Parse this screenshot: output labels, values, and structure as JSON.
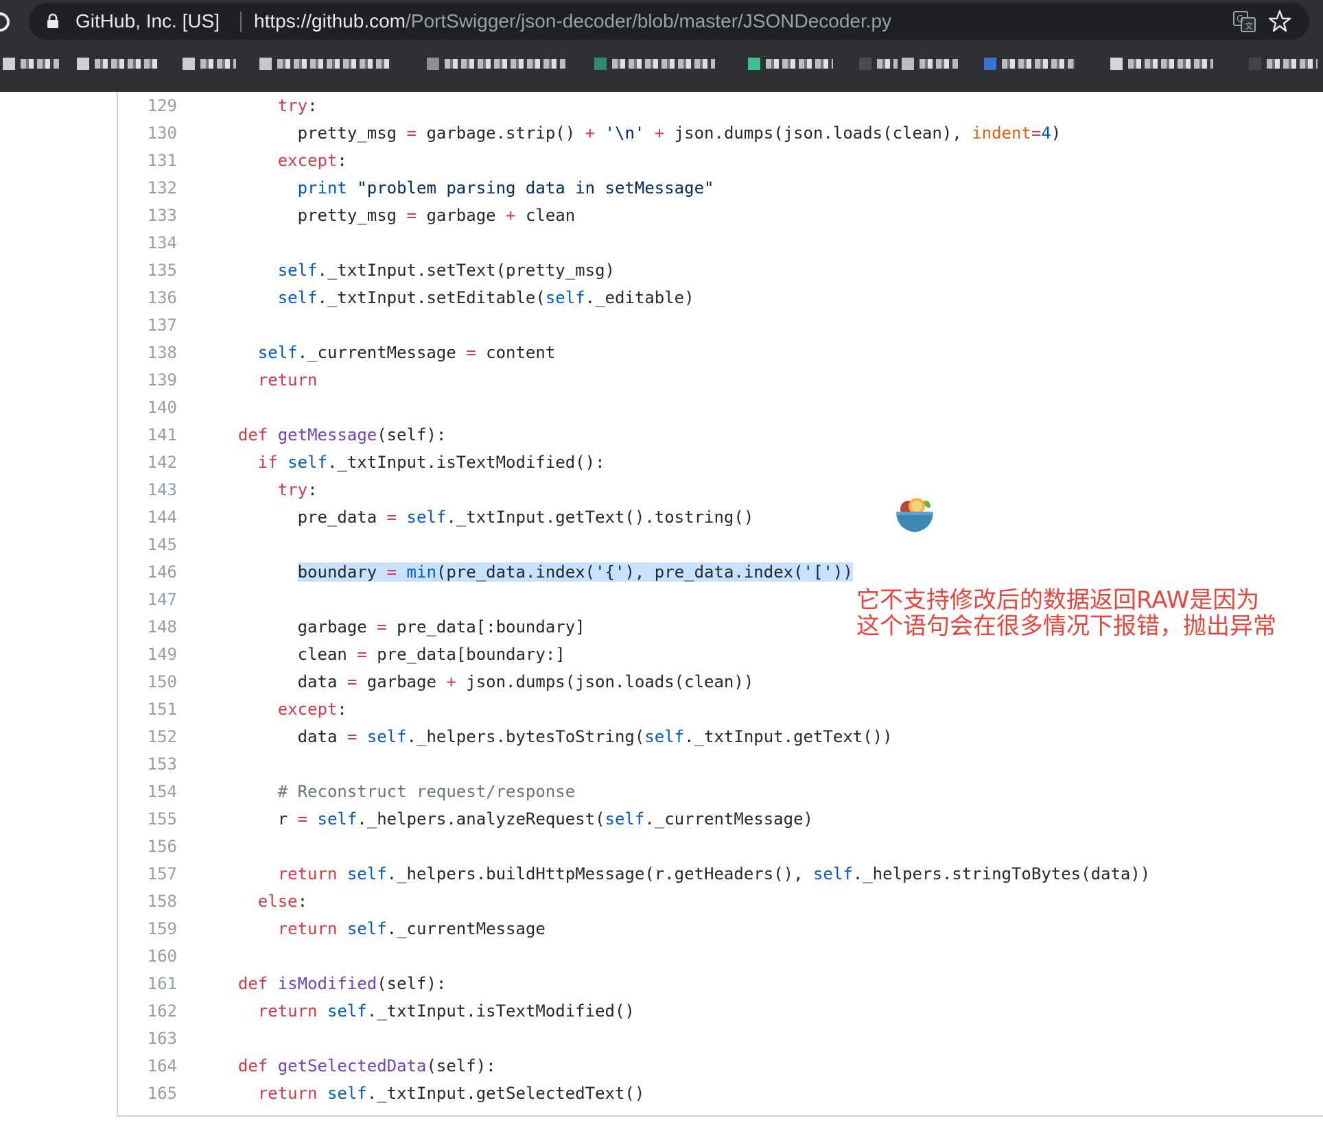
{
  "browser": {
    "site_identity": "GitHub, Inc. [US]",
    "url_host": "https://github.com",
    "url_path": "/PortSwigger/json-decoder/blob/master/JSONDecoder.py",
    "icons": [
      "reload-icon",
      "lock-icon",
      "translate-icon",
      "star-icon"
    ],
    "bookmarks_note_hidden": true
  },
  "code": {
    "lines": [
      {
        "n": "129",
        "html": "      <span class=\"kw\">try</span>:"
      },
      {
        "n": "130",
        "html": "        pretty_msg <span class=\"kw\">=</span> garbage.strip() <span class=\"kw\">+</span> <span class=\"st\">'\\n'</span> <span class=\"kw\">+</span> json.dumps(json.loads(clean), <span class=\"pm\">indent</span><span class=\"kw\">=</span><span class=\"sf\">4</span>)"
      },
      {
        "n": "131",
        "html": "      <span class=\"kw\">except</span>:"
      },
      {
        "n": "132",
        "html": "        <span class=\"sf\">print</span> <span class=\"st\">\"problem parsing data in setMessage\"</span>"
      },
      {
        "n": "133",
        "html": "        pretty_msg <span class=\"kw\">=</span> garbage <span class=\"kw\">+</span> clean"
      },
      {
        "n": "134",
        "html": ""
      },
      {
        "n": "135",
        "html": "      <span class=\"sf\">self</span>._txtInput.setText(pretty_msg)"
      },
      {
        "n": "136",
        "html": "      <span class=\"sf\">self</span>._txtInput.setEditable(<span class=\"sf\">self</span>._editable)"
      },
      {
        "n": "137",
        "html": ""
      },
      {
        "n": "138",
        "html": "    <span class=\"sf\">self</span>._currentMessage <span class=\"kw\">=</span> content"
      },
      {
        "n": "139",
        "html": "    <span class=\"kw\">return</span>"
      },
      {
        "n": "140",
        "html": ""
      },
      {
        "n": "141",
        "html": "  <span class=\"kw\">def</span> <span class=\"fn\">getMessage</span>(self):"
      },
      {
        "n": "142",
        "html": "    <span class=\"kw\">if</span> <span class=\"sf\">self</span>._txtInput.isTextModified():"
      },
      {
        "n": "143",
        "html": "      <span class=\"kw\">try</span>:"
      },
      {
        "n": "144",
        "html": "        pre_data <span class=\"kw\">=</span> <span class=\"sf\">self</span>._txtInput.getText().tostring()"
      },
      {
        "n": "145",
        "html": ""
      },
      {
        "n": "146",
        "html": "        <span class=\"hl\">boundary <span class=\"kw\">=</span> <span class=\"sf\">min</span>(pre_data.index(<span class=\"st\">'{'</span>), pre_data.index(<span class=\"st\">'['</span>))</span>"
      },
      {
        "n": "147",
        "html": ""
      },
      {
        "n": "148",
        "html": "        garbage <span class=\"kw\">=</span> pre_data[:boundary]"
      },
      {
        "n": "149",
        "html": "        clean <span class=\"kw\">=</span> pre_data[boundary:]"
      },
      {
        "n": "150",
        "html": "        data <span class=\"kw\">=</span> garbage <span class=\"kw\">+</span> json.dumps(json.loads(clean))"
      },
      {
        "n": "151",
        "html": "      <span class=\"kw\">except</span>:"
      },
      {
        "n": "152",
        "html": "        data <span class=\"kw\">=</span> <span class=\"sf\">self</span>._helpers.bytesToString(<span class=\"sf\">self</span>._txtInput.getText())"
      },
      {
        "n": "153",
        "html": ""
      },
      {
        "n": "154",
        "html": "      <span class=\"cm\"># Reconstruct request/response</span>"
      },
      {
        "n": "155",
        "html": "      r <span class=\"kw\">=</span> <span class=\"sf\">self</span>._helpers.analyzeRequest(<span class=\"sf\">self</span>._currentMessage)"
      },
      {
        "n": "156",
        "html": ""
      },
      {
        "n": "157",
        "html": "      <span class=\"kw\">return</span> <span class=\"sf\">self</span>._helpers.buildHttpMessage(r.getHeaders(), <span class=\"sf\">self</span>._helpers.stringToBytes(data))"
      },
      {
        "n": "158",
        "html": "    <span class=\"kw\">else</span>:"
      },
      {
        "n": "159",
        "html": "      <span class=\"kw\">return</span> <span class=\"sf\">self</span>._currentMessage"
      },
      {
        "n": "160",
        "html": ""
      },
      {
        "n": "161",
        "html": "  <span class=\"kw\">def</span> <span class=\"fn\">isModified</span>(self):"
      },
      {
        "n": "162",
        "html": "    <span class=\"kw\">return</span> <span class=\"sf\">self</span>._txtInput.isTextModified()"
      },
      {
        "n": "163",
        "html": ""
      },
      {
        "n": "164",
        "html": "  <span class=\"kw\">def</span> <span class=\"fn\">getSelectedData</span>(self):"
      },
      {
        "n": "165",
        "html": "    <span class=\"kw\">return</span> <span class=\"sf\">self</span>._txtInput.getSelectedText()"
      }
    ]
  },
  "annotation": {
    "line1": "它不支持修改后的数据返回RAW是因为",
    "line2": "这个语句会在很多情况下报错，抛出异常"
  },
  "colors": {
    "keyword": "#d73a49",
    "builtin": "#005cc5",
    "function": "#6f42c1",
    "string": "#032f62",
    "param": "#e36209",
    "comment": "#6a737d",
    "selection": "#c8e1ff",
    "annotation": "#e8453c"
  }
}
